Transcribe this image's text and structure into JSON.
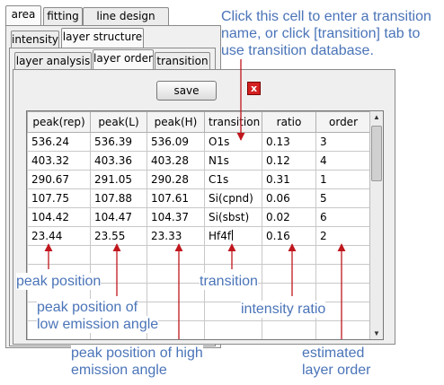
{
  "tabs_row1": {
    "area": "area",
    "fitting": "fitting",
    "line_design": "line design"
  },
  "tabs_row2": {
    "intensity": "intensity",
    "layer_structure": "layer structure"
  },
  "tabs_row3": {
    "layer_analysis": "layer analysis",
    "layer_order": "layer order",
    "transition": "transition"
  },
  "toolbar": {
    "save_label": "save",
    "close_label": "x"
  },
  "table": {
    "columns": [
      "peak(rep)",
      "peak(L)",
      "peak(H)",
      "transition",
      "ratio",
      "order"
    ],
    "rows": [
      [
        "536.24",
        "536.39",
        "536.09",
        "O1s",
        "0.13",
        "3"
      ],
      [
        "403.32",
        "403.36",
        "403.28",
        "N1s",
        "0.12",
        "4"
      ],
      [
        "290.67",
        "291.05",
        "290.28",
        "C1s",
        "0.31",
        "1"
      ],
      [
        "107.75",
        "107.88",
        "107.61",
        "Si(cpnd)",
        "0.06",
        "5"
      ],
      [
        "104.42",
        "104.47",
        "104.37",
        "Si(sbst)",
        "0.02",
        "6"
      ],
      [
        "23.44",
        "23.55",
        "23.33",
        "Hf4f",
        "0.16",
        "2"
      ]
    ]
  },
  "annotations": {
    "top_line1": "Click this cell to enter a transition",
    "top_line2": "name, or click [transition] tab to",
    "top_line3": "use transition database.",
    "peak_position": "peak position",
    "low_angle_line1": "peak position of",
    "low_angle_line2": "low emission angle",
    "transition": "transition",
    "intensity_ratio": "intensity  ratio",
    "high_angle_line1": "peak position of high",
    "high_angle_line2": "emission angle",
    "order_line1": "estimated",
    "order_line2": "layer order"
  },
  "colors": {
    "annotation_text": "#4a74b8",
    "arrow": "#c0161d",
    "close_button": "#d42020"
  }
}
